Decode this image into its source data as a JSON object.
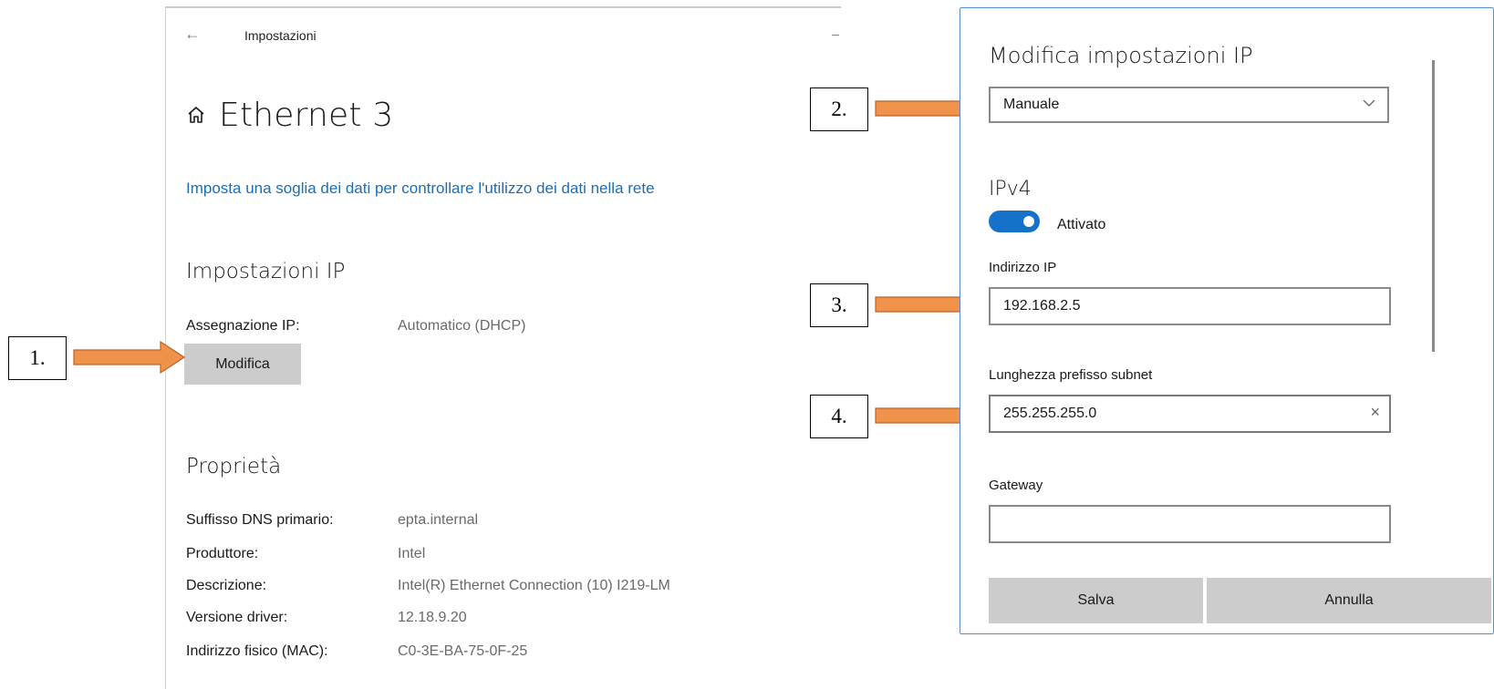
{
  "settings": {
    "app_title": "Impostazioni",
    "page_title": "Ethernet 3",
    "data_link": "Imposta una soglia dei dati per controllare l'utilizzo dei dati nella rete",
    "ip_section_title": "Impostazioni IP",
    "ip_assignment_label": "Assegnazione IP:",
    "ip_assignment_value": "Automatico (DHCP)",
    "edit_button": "Modifica",
    "properties_title": "Proprietà",
    "properties": [
      {
        "label": "Suffisso DNS primario:",
        "value": "epta.internal"
      },
      {
        "label": "Produttore:",
        "value": "Intel"
      },
      {
        "label": "Descrizione:",
        "value": "Intel(R) Ethernet Connection (10) I219-LM"
      },
      {
        "label": "Versione driver:",
        "value": "12.18.9.20"
      },
      {
        "label": "Indirizzo fisico (MAC):",
        "value": "C0-3E-BA-75-0F-25"
      }
    ]
  },
  "steps": [
    "1.",
    "2.",
    "3.",
    "4."
  ],
  "dialog": {
    "title": "Modifica impostazioni IP",
    "mode_selected": "Manuale",
    "ipv4_heading": "IPv4",
    "ipv4_toggle_state": "Attivato",
    "ip_address_label": "Indirizzo IP",
    "ip_address_value": "192.168.2.5",
    "subnet_label": "Lunghezza prefisso subnet",
    "subnet_value": "255.255.255.0",
    "gateway_label": "Gateway",
    "gateway_value": "",
    "save_button": "Salva",
    "cancel_button": "Annulla"
  },
  "colors": {
    "accent_blue": "#1672c8",
    "link_blue": "#1a6fb8",
    "arrow_orange": "#f0924a",
    "button_gray": "#cccccc"
  },
  "icons": [
    "back-arrow-icon",
    "home-icon",
    "chevron-down-icon",
    "clear-icon"
  ]
}
